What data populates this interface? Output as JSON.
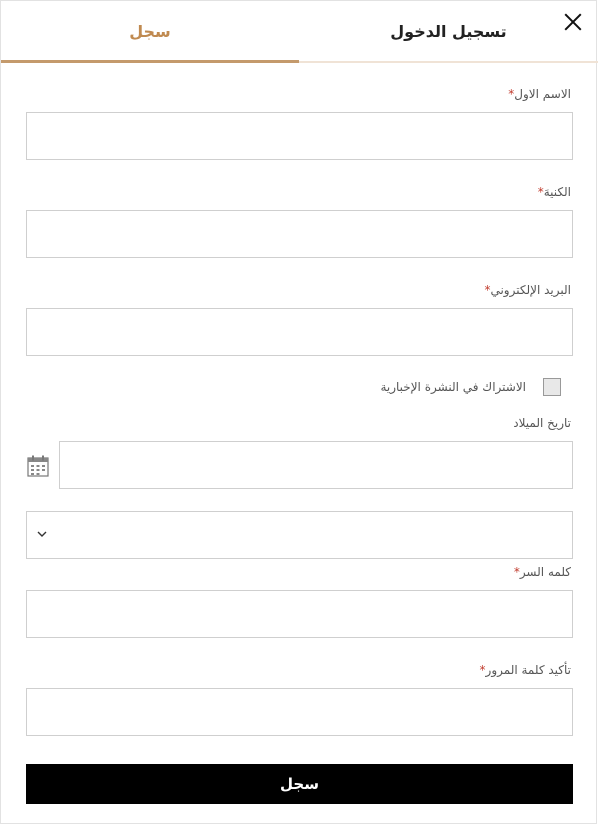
{
  "tabs": {
    "login_label": "تسجيل الدخول",
    "signup_label": "سجل"
  },
  "form": {
    "first_name": {
      "label": "الاسم الاول",
      "required_mark": "*",
      "value": ""
    },
    "last_name": {
      "label": "الكنيهَ",
      "required_mark": "*",
      "value": ""
    },
    "email": {
      "label": "البريد الإلكتروني",
      "required_mark": "*",
      "value": ""
    },
    "newsletter": {
      "label": "الاشتراك في النشرة الإخبارية",
      "checked": false
    },
    "birthdate": {
      "label": "تاريخ الميلاد",
      "value": ""
    },
    "select": {
      "value": ""
    },
    "password": {
      "label": "كلمه السر",
      "required_mark": "*",
      "value": ""
    },
    "confirm_password": {
      "label": "تأكيد كلمة المرور",
      "required_mark": "*",
      "value": ""
    },
    "submit_label": "سجل"
  },
  "icons": {
    "close": "close-icon",
    "calendar": "calendar-icon",
    "dropdown": "chevron-down-icon"
  },
  "colors": {
    "accent": "#c49a6c",
    "active_tab_text": "#c08a50",
    "required": "#c0392b",
    "button": "#000000"
  }
}
